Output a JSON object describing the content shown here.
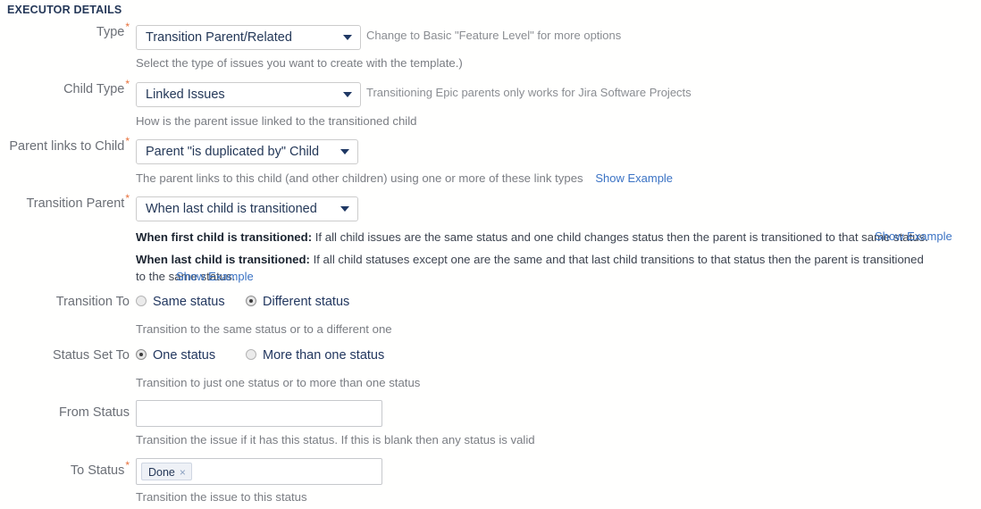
{
  "section": {
    "title": "EXECUTOR DETAILS"
  },
  "fields": {
    "type": {
      "label": "Type",
      "required_mark": "*",
      "value": "Transition Parent/Related",
      "hint": "Select the type of issues you want to create with the template.)",
      "side_hint": "Change to Basic \"Feature Level\" for more options"
    },
    "child_type": {
      "label": "Child Type",
      "required_mark": "*",
      "value": "Linked Issues",
      "hint": "How is the parent issue linked to the transitioned child",
      "side_hint": "Transitioning Epic parents only works for Jira Software Projects"
    },
    "parent_links_to_child": {
      "label": "Parent links to Child",
      "required_mark": "*",
      "value": "Parent \"is duplicated by\" Child",
      "hint": "The parent links to this child (and other children) using one or more of these link types",
      "hint_link": "Show Example"
    },
    "transition_parent": {
      "label": "Transition Parent",
      "required_mark": "*",
      "value": "When last child is transitioned",
      "explain_1_bold": "When first child is transitioned:",
      "explain_1_text": " If all child issues are the same status and one child changes status then the parent is transitioned to that same status.",
      "explain_1_link": "Show Example",
      "explain_2_bold": "When last child is transitioned:",
      "explain_2_text": " If all child statuses except one are the same and that last child transitions to that status then the parent is transitioned to the same status.",
      "explain_2_link": "Show Example"
    },
    "transition_to": {
      "label": "Transition To",
      "options": [
        {
          "label": "Same status",
          "checked": false
        },
        {
          "label": "Different status",
          "checked": true
        }
      ],
      "hint": "Transition to the same status or to a different one"
    },
    "status_set_to": {
      "label": "Status Set To",
      "options": [
        {
          "label": "One status",
          "checked": true
        },
        {
          "label": "More than one status",
          "checked": false
        }
      ],
      "hint": "Transition to just one status or to more than one status"
    },
    "from_status": {
      "label": "From Status",
      "value": "",
      "placeholder": "",
      "hint": "Transition the issue if it has this status. If this is blank then any status is valid"
    },
    "to_status": {
      "label": "To Status",
      "required_mark": "*",
      "tags": [
        {
          "label": "Done",
          "remove_icon": "×"
        }
      ],
      "hint": "Transition the issue to this status"
    }
  },
  "colors": {
    "header": "#253858",
    "label": "#6b6f76",
    "required": "#e8703a",
    "link": "#3b73c4",
    "value_text": "#243858",
    "hint": "#7a7d83",
    "tag_bg": "#eef1f6"
  }
}
